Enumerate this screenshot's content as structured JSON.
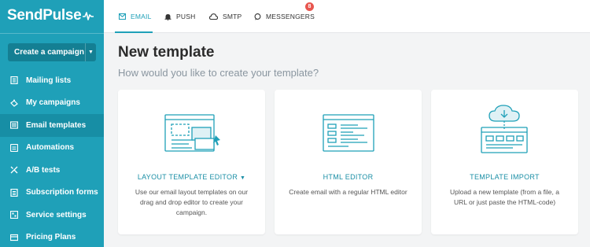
{
  "brand": {
    "name": "SendPulse",
    "accent": "#1fa0b8"
  },
  "sidebar": {
    "create_button": "Create a campaign",
    "items": [
      {
        "label": "Mailing lists",
        "icon": "list-icon",
        "active": false
      },
      {
        "label": "My campaigns",
        "icon": "megaphone-icon",
        "active": false
      },
      {
        "label": "Email templates",
        "icon": "template-icon",
        "active": true
      },
      {
        "label": "Automations",
        "icon": "automation-icon",
        "active": false
      },
      {
        "label": "A/B tests",
        "icon": "split-icon",
        "active": false
      },
      {
        "label": "Subscription forms",
        "icon": "form-icon",
        "active": false
      },
      {
        "label": "Service settings",
        "icon": "settings-icon",
        "active": false
      },
      {
        "label": "Pricing Plans",
        "icon": "pricing-icon",
        "active": false
      }
    ]
  },
  "tabs": [
    {
      "label": "EMAIL",
      "icon": "mail-icon",
      "active": true
    },
    {
      "label": "PUSH",
      "icon": "bell-icon",
      "active": false
    },
    {
      "label": "SMTP",
      "icon": "cloud-icon",
      "active": false
    },
    {
      "label": "MESSENGERS",
      "icon": "chat-icon",
      "active": false,
      "badge": "8"
    }
  ],
  "main": {
    "title": "New template",
    "subtitle": "How would you like to create your template?",
    "cards": [
      {
        "title": "LAYOUT TEMPLATE EDITOR",
        "description": "Use our email layout templates on our drag and drop editor to create your campaign."
      },
      {
        "title": "HTML EDITOR",
        "description": "Create email with a regular HTML editor"
      },
      {
        "title": "TEMPLATE IMPORT",
        "description": "Upload a new template (from a file, a URL or just paste the HTML-code)"
      }
    ]
  }
}
